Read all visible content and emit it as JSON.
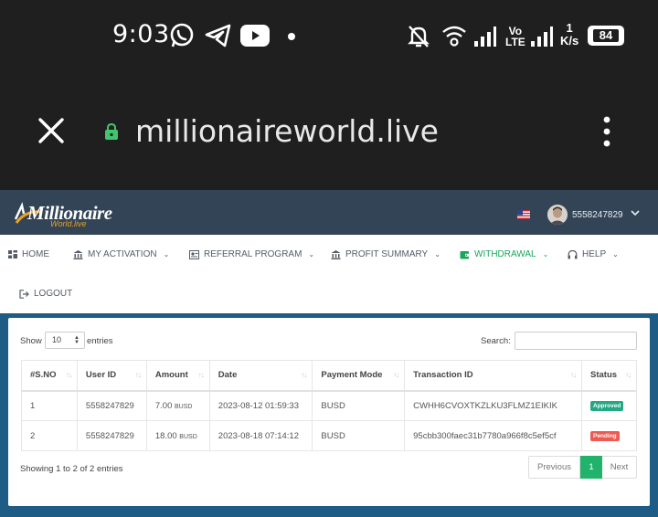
{
  "status_bar": {
    "time": "9:03",
    "network_speed_top": "1",
    "network_speed_unit": "K/s",
    "network_type": "Vo LTE",
    "battery": "84",
    "icons": [
      "whatsapp-icon",
      "telegram-icon",
      "youtube-icon",
      "dot-icon",
      "bell-off-icon",
      "wifi-icon",
      "signal-icon",
      "volte-icon",
      "signal-icon",
      "battery-icon"
    ]
  },
  "browser": {
    "url": "millionaireworld.live",
    "icons": [
      "close-icon",
      "lock-icon",
      "kebab-menu-icon"
    ]
  },
  "header": {
    "logo_text": "Millionaire",
    "logo_sub": "World.live",
    "flag": "us-flag-icon",
    "user_id": "5558247829"
  },
  "nav": {
    "items": [
      {
        "label": "HOME",
        "icon": "dashboard-icon"
      },
      {
        "label": "MY ACTIVATION",
        "icon": "bank-icon"
      },
      {
        "label": "REFERRAL PROGRAM",
        "icon": "referral-icon"
      },
      {
        "label": "PROFIT SUMMARY",
        "icon": "bank-icon"
      },
      {
        "label": "WITHDRAWAL",
        "icon": "wallet-icon"
      },
      {
        "label": "HELP",
        "icon": "headphones-icon"
      },
      {
        "label": "LOGOUT",
        "icon": "logout-icon"
      }
    ]
  },
  "table_controls": {
    "show_label": "Show",
    "page_size": "10",
    "entries_label": "entries",
    "search_label": "Search:",
    "search_value": ""
  },
  "table": {
    "columns": [
      "#S.NO",
      "User ID",
      "Amount",
      "Date",
      "Payment Mode",
      "Transaction ID",
      "Status"
    ],
    "rows": [
      {
        "sno": "1",
        "user_id": "5558247829",
        "amount": "7.00",
        "currency": "BUSD",
        "date": "2023-08-12 01:59:33",
        "payment_mode": "BUSD",
        "txn_id": "CWHH6CVOXTKZLKU3FLMZ1EIKIK",
        "status": "Approved"
      },
      {
        "sno": "2",
        "user_id": "5558247829",
        "amount": "18.00",
        "currency": "BUSD",
        "date": "2023-08-18 07:14:12",
        "payment_mode": "BUSD",
        "txn_id": "95cbb300faec31b7780a966f8c5ef5cf",
        "status": "Pending"
      }
    ]
  },
  "footer": {
    "info": "Showing 1 to 2 of 2 entries",
    "previous": "Previous",
    "page": "1",
    "next": "Next"
  },
  "colors": {
    "header_bg": "#324456",
    "content_bg": "#1e5c86",
    "accent_green": "#21b26b",
    "approved": "#22a882",
    "pending": "#ee5a52",
    "phone_bar": "#1f1f1f"
  }
}
